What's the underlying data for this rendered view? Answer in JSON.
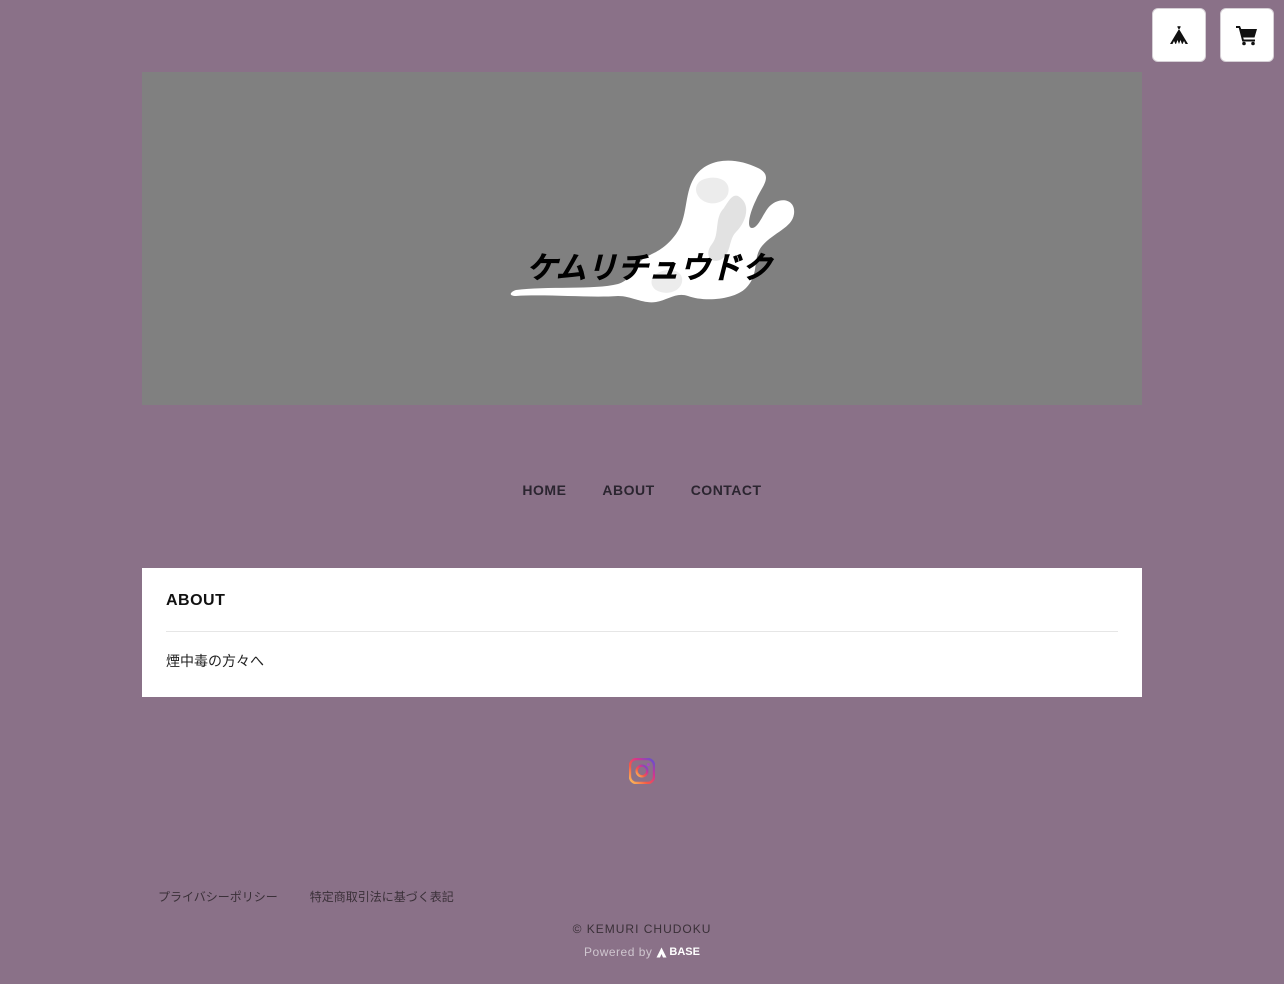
{
  "top_buttons": {
    "base_icon": "base-tent-icon",
    "cart_icon": "cart-icon"
  },
  "hero": {
    "logo_text": "ケムリチュウドク"
  },
  "nav": {
    "items": [
      {
        "label": "HOME"
      },
      {
        "label": "ABOUT"
      },
      {
        "label": "CONTACT"
      }
    ]
  },
  "about": {
    "title": "ABOUT",
    "body": "煙中毒の方々へ"
  },
  "social": {
    "icon": "instagram-icon"
  },
  "footer": {
    "links": [
      {
        "label": "プライバシーポリシー"
      },
      {
        "label": "特定商取引法に基づく表記"
      }
    ],
    "copyright": "© KEMURI CHUDOKU",
    "powered_by": "Powered by",
    "powered_brand": "BASE"
  },
  "colors": {
    "background": "#8a7188",
    "hero_background": "#808080",
    "card_background": "#ffffff"
  }
}
